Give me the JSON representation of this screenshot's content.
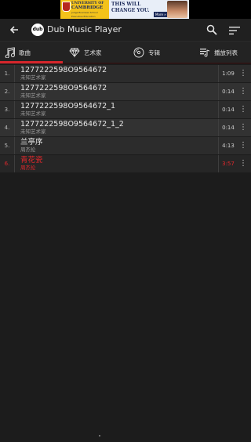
{
  "ad": {
    "left_line1": "UNIVERSITY OF",
    "left_line2": "CAMBRIDGE",
    "left_sub": "Judge Business School",
    "left_brand": "Executive Education",
    "right_line1": "THIS WILL",
    "right_line2": "CHANGE YOU.",
    "more_label": "More »"
  },
  "appbar": {
    "logo_text": "dub",
    "title": "Dub Music Player",
    "back_icon": "arrow-left-icon",
    "search_icon": "search-icon",
    "sort_icon": "sort-icon"
  },
  "tabs": [
    {
      "label": "歌曲",
      "icon": "music-note-icon"
    },
    {
      "label": "艺术家",
      "icon": "diamond-icon"
    },
    {
      "label": "专辑",
      "icon": "disc-icon"
    },
    {
      "label": "播放列表",
      "icon": "playlist-icon"
    }
  ],
  "songs": [
    {
      "num": "1.",
      "title": "1277222598O9564672",
      "artist": "未知艺术家",
      "duration": "1:09"
    },
    {
      "num": "2.",
      "title": "1277222598O9564672",
      "artist": "未知艺术家",
      "duration": "0:14"
    },
    {
      "num": "3.",
      "title": "1277222598O9564672_1",
      "artist": "未知艺术家",
      "duration": "0:14"
    },
    {
      "num": "4.",
      "title": "1277222598O9564672_1_2",
      "artist": "未知艺术家",
      "duration": "0:14"
    },
    {
      "num": "5.",
      "title": "兰亭序",
      "artist": "周杰伦",
      "duration": "4:13"
    },
    {
      "num": "6.",
      "title": "青花瓷",
      "artist": "周杰伦",
      "duration": "3:57"
    }
  ],
  "colors": {
    "accent": "#d7262c",
    "background": "#1c1c1c"
  }
}
